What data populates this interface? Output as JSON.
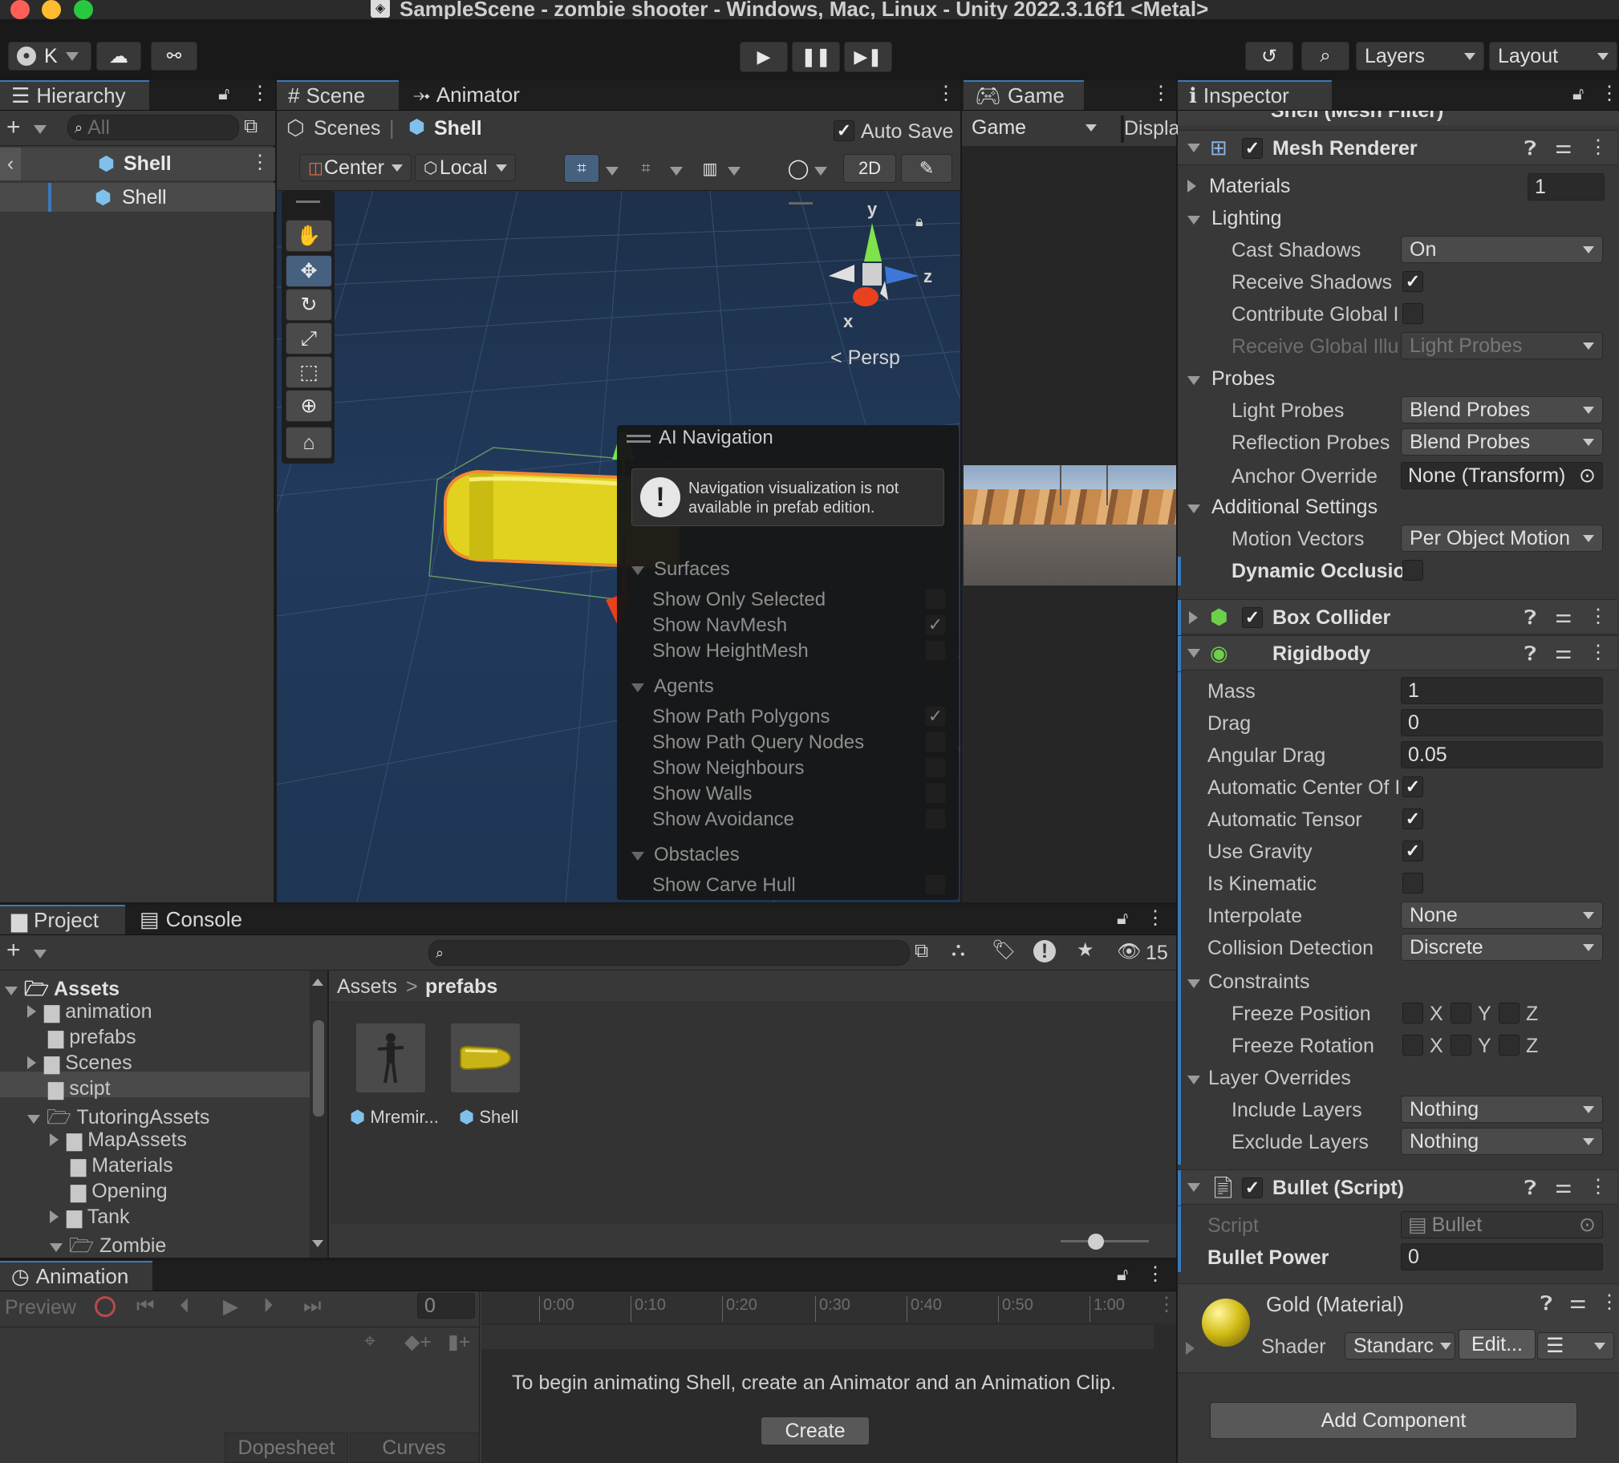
{
  "window": {
    "title": "SampleScene - zombie shooter - Windows, Mac, Linux - Unity 2022.3.16f1 <Metal>"
  },
  "toolbar": {
    "account": "K",
    "layers": "Layers",
    "layout": "Layout"
  },
  "hierarchy": {
    "tab": "Hierarchy",
    "search_placeholder": "All",
    "root": "Shell",
    "child": "Shell"
  },
  "scene": {
    "tab_scene": "Scene",
    "tab_animator": "Animator",
    "breadcrumb_scenes": "Scenes",
    "breadcrumb_sep": "|",
    "breadcrumb_obj": "Shell",
    "auto_save": "Auto Save",
    "pivot": "Center",
    "space": "Local",
    "mode_2d": "2D",
    "gizmo_y": "y",
    "gizmo_z": "z",
    "gizmo_x": "x",
    "persp": "Persp"
  },
  "ainav": {
    "title": "AI Navigation",
    "warning": "Navigation visualization is not available in prefab edition.",
    "surfaces": "Surfaces",
    "show_only_selected": "Show Only Selected",
    "show_navmesh": "Show NavMesh",
    "show_heightmesh": "Show HeightMesh",
    "agents": "Agents",
    "show_path_polygons": "Show Path Polygons",
    "show_path_query": "Show Path Query Nodes",
    "show_neighbours": "Show Neighbours",
    "show_walls": "Show Walls",
    "show_avoidance": "Show Avoidance",
    "obstacles": "Obstacles",
    "show_carve_hull": "Show Carve Hull"
  },
  "game": {
    "tab": "Game",
    "mode": "Game",
    "display": "Displa"
  },
  "inspector": {
    "tab": "Inspector",
    "mesh_filter": "Shell (Mesh Filter)",
    "mesh_renderer": {
      "title": "Mesh Renderer",
      "materials": "Materials",
      "materials_count": "1",
      "lighting": "Lighting",
      "cast_shadows": "Cast Shadows",
      "cast_shadows_val": "On",
      "receive_shadows": "Receive Shadows",
      "contribute_gi": "Contribute Global I",
      "receive_gi": "Receive Global Illu",
      "receive_gi_val": "Light Probes",
      "probes": "Probes",
      "light_probes": "Light Probes",
      "light_probes_val": "Blend Probes",
      "reflection_probes": "Reflection Probes",
      "reflection_probes_val": "Blend Probes",
      "anchor_override": "Anchor Override",
      "anchor_override_val": "None (Transform)",
      "additional": "Additional Settings",
      "motion_vectors": "Motion Vectors",
      "motion_vectors_val": "Per Object Motion",
      "dynamic_occlusion": "Dynamic Occlusio"
    },
    "box_collider": "Box Collider",
    "rigidbody": {
      "title": "Rigidbody",
      "mass": "Mass",
      "mass_val": "1",
      "drag": "Drag",
      "drag_val": "0",
      "angular_drag": "Angular Drag",
      "angular_drag_val": "0.05",
      "auto_center": "Automatic Center Of I",
      "auto_tensor": "Automatic Tensor",
      "use_gravity": "Use Gravity",
      "is_kinematic": "Is Kinematic",
      "interpolate": "Interpolate",
      "interpolate_val": "None",
      "collision": "Collision Detection",
      "collision_val": "Discrete",
      "constraints": "Constraints",
      "freeze_pos": "Freeze Position",
      "freeze_rot": "Freeze Rotation",
      "x": "X",
      "y": "Y",
      "z": "Z",
      "layer_overrides": "Layer Overrides",
      "include_layers": "Include Layers",
      "include_val": "Nothing",
      "exclude_layers": "Exclude Layers",
      "exclude_val": "Nothing"
    },
    "bullet": {
      "title": "Bullet (Script)",
      "script": "Script",
      "script_val": "Bullet",
      "power": "Bullet Power",
      "power_val": "0"
    },
    "material": {
      "title": "Gold (Material)",
      "shader": "Shader",
      "shader_val": "Standarc",
      "edit": "Edit..."
    },
    "add_component": "Add Component"
  },
  "project": {
    "tab_project": "Project",
    "tab_console": "Console",
    "hidden_count": "15",
    "tree": [
      "Assets",
      "animation",
      "prefabs",
      "Scenes",
      "scipt",
      "TutoringAssets",
      "MapAssets",
      "Materials",
      "Opening",
      "Tank",
      "Zombie"
    ],
    "crumb_root": "Assets",
    "crumb_sep": ">",
    "crumb_leaf": "prefabs",
    "assets": [
      "Mremir...",
      "Shell"
    ]
  },
  "animation": {
    "tab": "Animation",
    "preview": "Preview",
    "frame": "0",
    "times": [
      "0:00",
      "0:10",
      "0:20",
      "0:30",
      "0:40",
      "0:50",
      "1:00"
    ],
    "message": "To begin animating Shell, create an Animator and an Animation Clip.",
    "create": "Create",
    "dopesheet": "Dopesheet",
    "curves": "Curves"
  }
}
